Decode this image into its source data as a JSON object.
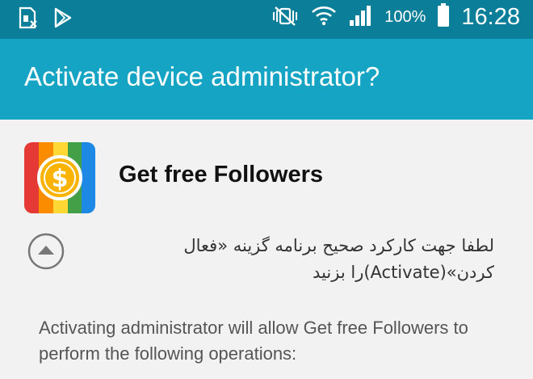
{
  "status_bar": {
    "battery_percent": "100%",
    "time": "16:28",
    "icons": [
      "sim-alert-icon",
      "play-store-icon",
      "vibrate-mute-icon",
      "wifi-icon",
      "signal-icon",
      "battery-icon"
    ]
  },
  "dialog": {
    "title": "Activate device administrator?",
    "app_name": "Get free Followers",
    "description": "لطفا جهت کارکرد صحیح برنامه گزینه «فعال کردن»(Activate)را بزنید",
    "info": "Activating administrator will allow Get free Followers  to perform the following operations:"
  },
  "colors": {
    "status_bar": "#0b7f99",
    "title_bar": "#16a4c4",
    "background": "#f2f2f2"
  }
}
